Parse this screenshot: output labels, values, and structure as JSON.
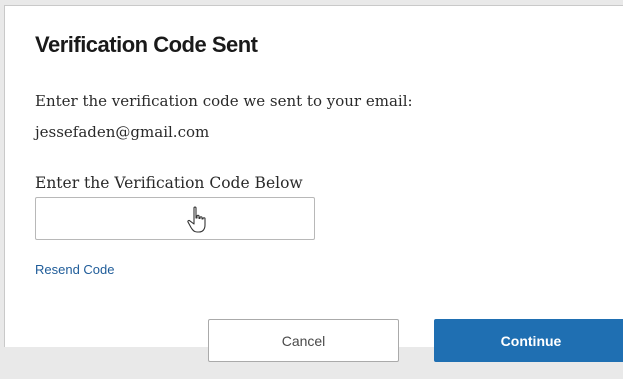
{
  "dialog": {
    "title": "Verification Code Sent",
    "instruction": "Enter the verification code we sent to your email:",
    "email": "jessefaden@gmail.com",
    "field_label": "Enter the Verification Code Below",
    "code_value": "",
    "resend_label": "Resend Code",
    "cancel_label": "Cancel",
    "continue_label": "Continue"
  },
  "colors": {
    "primary": "#1f6fb2",
    "link": "#1f5c99"
  },
  "icons": {
    "cursor": "hand-pointer-icon"
  }
}
